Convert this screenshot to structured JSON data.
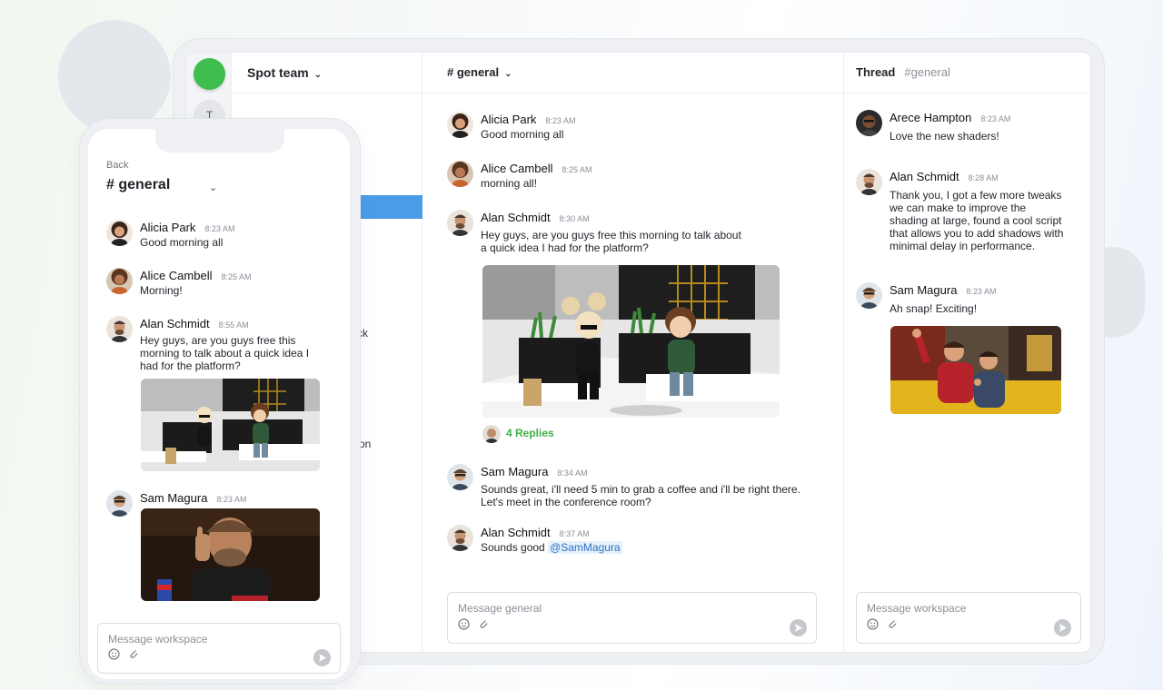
{
  "tablet": {
    "workspace_rail": {
      "item_letter": "T"
    },
    "sidebar": {
      "team_name": "Spot team",
      "fragments": [
        "ck",
        "on"
      ]
    },
    "channel": {
      "title": "# general",
      "messages": [
        {
          "name": "Alicia Park",
          "time": "8:23 AM",
          "text": "Good morning all"
        },
        {
          "name": "Alice Cambell",
          "time": "8:25 AM",
          "text": "morning all!"
        },
        {
          "name": "Alan Schmidt",
          "time": "8:30 AM",
          "text": "Hey guys, are you guys free this morning to talk about a quick idea I had for the platform?"
        },
        {
          "name": "Sam Magura",
          "time": "8:34 AM",
          "text": "Sounds great, i'll need 5 min to grab a coffee and i'll be right there. Let's meet in the conference room?"
        },
        {
          "name": "Alan Schmidt",
          "time": "8:37 AM",
          "text": "Sounds good ",
          "mention": "@SamMagura"
        }
      ],
      "replies": "4 Replies",
      "composer_placeholder": "Message general"
    },
    "thread": {
      "title": "Thread",
      "channel": "#general",
      "messages": [
        {
          "name": "Arece Hampton",
          "time": "8:23 AM",
          "text": "Love the new shaders!"
        },
        {
          "name": "Alan Schmidt",
          "time": "8:28 AM",
          "text": "Thank you, I got a few more tweaks we can make to improve the shading at large, found a cool script that allows you to add shadows with minimal delay in performance."
        },
        {
          "name": "Sam Magura",
          "time": "8:23 AM",
          "text": "Ah snap! Exciting!"
        }
      ],
      "composer_placeholder": "Message workspace"
    }
  },
  "phone": {
    "back": "Back",
    "title": "# general",
    "messages": [
      {
        "name": "Alicia Park",
        "time": "8:23 AM",
        "text": "Good morning all"
      },
      {
        "name": "Alice Cambell",
        "time": "8:25 AM",
        "text": "Morning!"
      },
      {
        "name": "Alan Schmidt",
        "time": "8:55 AM",
        "text": "Hey guys, are you guys free this morning to talk about a quick idea I had for the platform?"
      },
      {
        "name": "Sam Magura",
        "time": "8:23 AM",
        "text": ""
      }
    ],
    "composer_placeholder": "Message workspace"
  },
  "colors": {
    "accent_green": "#3fbd4f",
    "selection_blue": "#4b9ce6",
    "reply_green": "#3fae4b",
    "mention_blue": "#2b72c4"
  },
  "icons": [
    "chevron-down-icon",
    "emoji-icon",
    "attach-icon",
    "send-icon"
  ]
}
